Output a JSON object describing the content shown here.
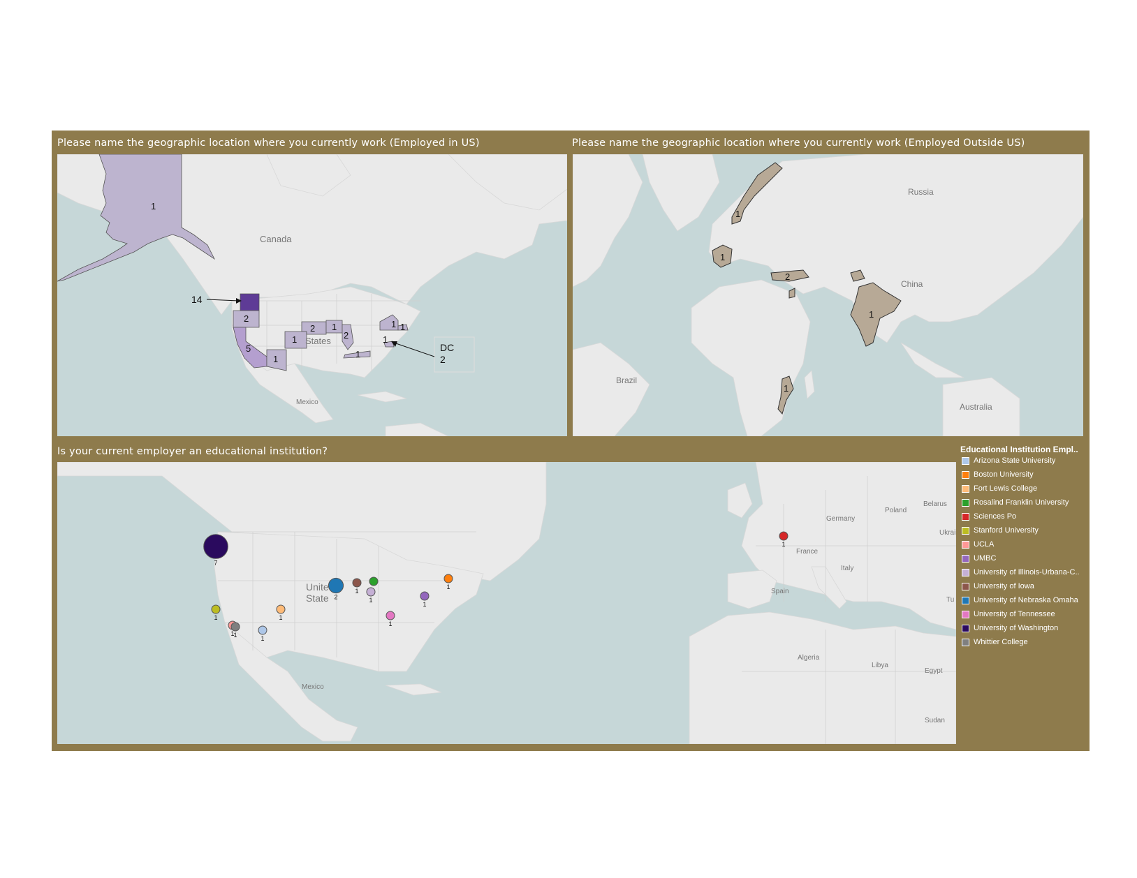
{
  "colors": {
    "frame": "#8e7b4c",
    "water": "#c6d7d8",
    "land": "#eaeaea",
    "us_low": "#bdb4cf",
    "us_high": "#5e3b96",
    "outside": "#b7a996"
  },
  "panels": {
    "us_title": "Please name the geographic location where you currently work (Employed in US)",
    "outside_title": "Please name the geographic location where you currently work (Employed Outside US)",
    "edu_title": "Is your current employer an educational institution?"
  },
  "us_map": {
    "place_labels": {
      "canada": "Canada",
      "states": "States",
      "mexico": "Mexico"
    },
    "states": [
      {
        "state": "Alaska",
        "count": "1"
      },
      {
        "state": "Washington",
        "count": "14",
        "callout": true
      },
      {
        "state": "Oregon",
        "count": "2"
      },
      {
        "state": "California",
        "count": "5"
      },
      {
        "state": "Arizona",
        "count": "1"
      },
      {
        "state": "Colorado",
        "count": "1"
      },
      {
        "state": "Nebraska",
        "count": "2"
      },
      {
        "state": "Iowa",
        "count": "1"
      },
      {
        "state": "Illinois",
        "count": "2"
      },
      {
        "state": "Tennessee",
        "count": "1"
      },
      {
        "state": "New York",
        "count": "1"
      },
      {
        "state": "Massachusetts",
        "count": "1"
      },
      {
        "state": "Maryland",
        "count": "1"
      }
    ],
    "dc_callout": {
      "label": "DC",
      "count": "2"
    }
  },
  "outside_map": {
    "place_labels": {
      "russia": "Russia",
      "china": "China",
      "brazil": "Brazil",
      "australia": "Australia"
    },
    "countries": [
      {
        "country": "Norway",
        "count": "1"
      },
      {
        "country": "France",
        "count": "1"
      },
      {
        "country": "Turkey",
        "count": "2"
      },
      {
        "country": "India",
        "count": "1"
      },
      {
        "country": "Mozambique",
        "count": "1"
      }
    ]
  },
  "edu_map": {
    "place_labels": {
      "united_states_1": "Unite",
      "united_states_2": "State",
      "mexico": "Mexico",
      "germany": "Germany",
      "poland": "Poland",
      "belarus": "Belarus",
      "ukraine": "Ukrai",
      "france": "France",
      "italy": "Italy",
      "spain": "Spain",
      "turkey": "Tu",
      "algeria": "Algeria",
      "libya": "Libya",
      "egypt": "Egypt",
      "sudan": "Sudan"
    },
    "markers": [
      {
        "institution": "University of Washington",
        "count": "7",
        "color": "#2a0a5e"
      },
      {
        "institution": "Stanford University",
        "count": "1",
        "color": "#bcbd22"
      },
      {
        "institution": "UCLA",
        "count": "1",
        "color": "#ff9896"
      },
      {
        "institution": "Whittier College",
        "count": "1",
        "color": "#7f7f7f"
      },
      {
        "institution": "Arizona State University",
        "count": "1",
        "color": "#aec7e8"
      },
      {
        "institution": "Fort Lewis College",
        "count": "1",
        "color": "#ffbb78"
      },
      {
        "institution": "University of Nebraska Omaha",
        "count": "2",
        "color": "#1f77b4"
      },
      {
        "institution": "University of Iowa",
        "count": "1",
        "color": "#8c564b"
      },
      {
        "institution": "Rosalind Franklin University",
        "count": "",
        "color": "#2ca02c"
      },
      {
        "institution": "University of Illinois-Urbana-C...",
        "count": "1",
        "color": "#c5b0d5"
      },
      {
        "institution": "University of Tennessee",
        "count": "1",
        "color": "#e377c2"
      },
      {
        "institution": "UMBC",
        "count": "1",
        "color": "#9467bd"
      },
      {
        "institution": "Boston University",
        "count": "1",
        "color": "#ff7f0e"
      },
      {
        "institution": "Sciences Po",
        "count": "1",
        "color": "#d62728"
      }
    ]
  },
  "legend": {
    "title": "Educational Institution Empl..",
    "items": [
      {
        "label": "Arizona State University",
        "color": "#aec7e8"
      },
      {
        "label": "Boston University",
        "color": "#ff7f0e"
      },
      {
        "label": "Fort Lewis College",
        "color": "#ffbb78"
      },
      {
        "label": "Rosalind Franklin University",
        "color": "#2ca02c"
      },
      {
        "label": "Sciences Po",
        "color": "#d62728"
      },
      {
        "label": "Stanford University",
        "color": "#bcbd22"
      },
      {
        "label": "UCLA",
        "color": "#ff9896"
      },
      {
        "label": "UMBC",
        "color": "#9467bd"
      },
      {
        "label": "University of Illinois-Urbana-C..",
        "color": "#c5b0d5"
      },
      {
        "label": "University of Iowa",
        "color": "#8c564b"
      },
      {
        "label": "University of Nebraska Omaha",
        "color": "#1f77b4"
      },
      {
        "label": "University of Tennessee",
        "color": "#e377c2"
      },
      {
        "label": "University of Washington",
        "color": "#2a0a5e"
      },
      {
        "label": "Whittier College",
        "color": "#7f7f7f"
      }
    ]
  }
}
